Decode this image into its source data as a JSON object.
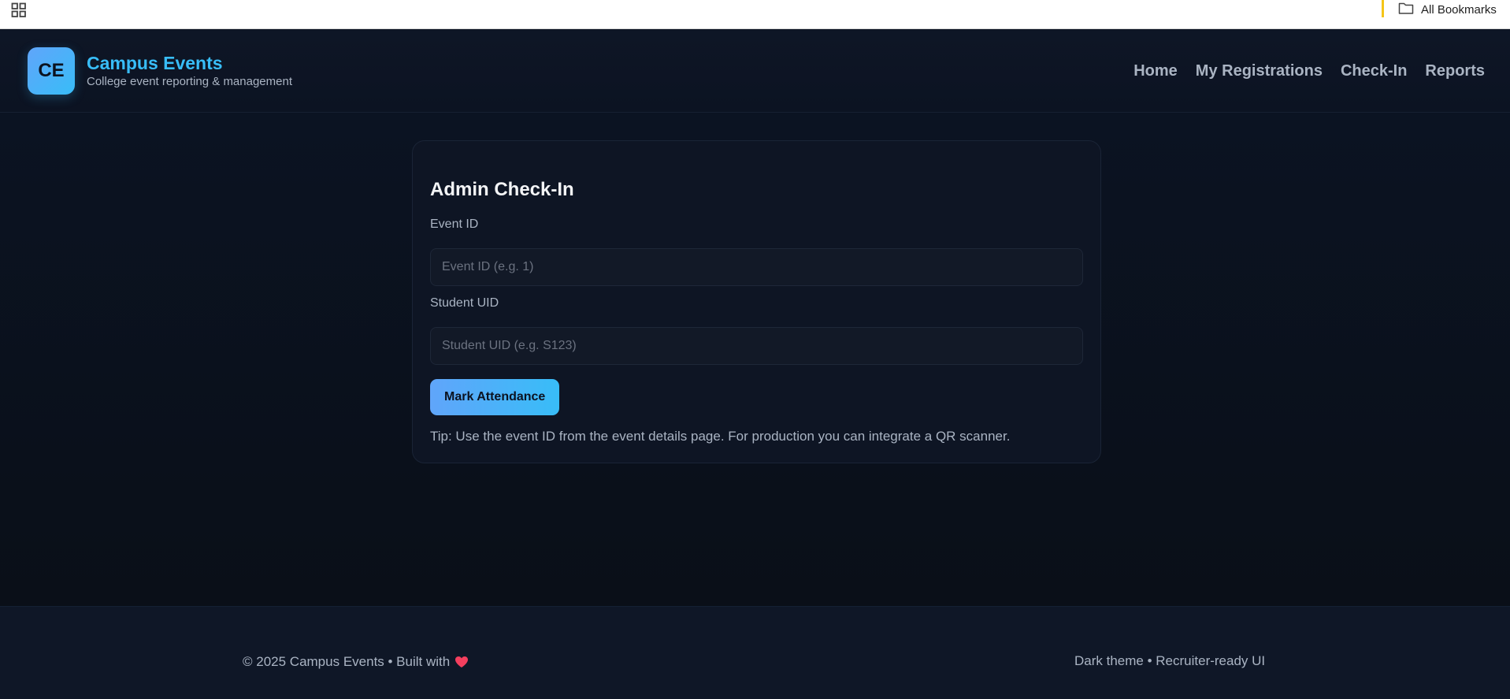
{
  "browser": {
    "bookmarks_folder_label": "All Bookmarks",
    "divider_color": "#f5c518"
  },
  "header": {
    "logo_text": "CE",
    "title": "Campus Events",
    "subtitle": "College event reporting & management",
    "nav": [
      {
        "label": "Home"
      },
      {
        "label": "My Registrations"
      },
      {
        "label": "Check-In"
      },
      {
        "label": "Reports"
      }
    ]
  },
  "form": {
    "title": "Admin Check-In",
    "event_id": {
      "label": "Event ID",
      "value": "",
      "placeholder": "Event ID (e.g. 1)"
    },
    "student_uid": {
      "label": "Student UID",
      "value": "",
      "placeholder": "Student UID (e.g. S123)"
    },
    "submit_label": "Mark Attendance",
    "tip": "Tip: Use the event ID from the event details page. For production you can integrate a QR scanner."
  },
  "footer": {
    "left_text": "© 2025 Campus Events • Built with",
    "heart_icon": "heart-icon",
    "right_text": "Dark theme • Recruiter-ready UI"
  },
  "colors": {
    "accent": "#38bdf8",
    "accent_start": "#60a5fa",
    "background": "#0b1220",
    "card": "#0e1524",
    "muted_text": "#aab4c3",
    "heart": "#f43f5e"
  }
}
